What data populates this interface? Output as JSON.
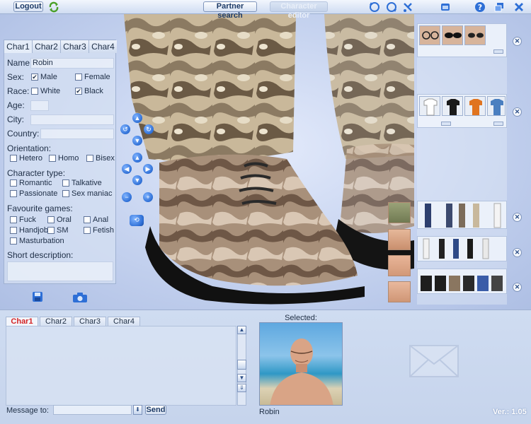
{
  "topbar": {
    "logout_label": "Logout",
    "partner_search_label": "Partner search",
    "character_editor_label": "Character editor"
  },
  "profile": {
    "tabs": [
      "Char1",
      "Char2",
      "Char3",
      "Char4"
    ],
    "name_label": "Name:",
    "name_value": "Robin",
    "sex_label": "Sex:",
    "sex_options": {
      "male": "Male",
      "female": "Female"
    },
    "race_label": "Race:",
    "race_options": {
      "white": "White",
      "black": "Black"
    },
    "age_label": "Age:",
    "city_label": "City:",
    "country_label": "Country:",
    "orientation_label": "Orientation:",
    "orientation_options": {
      "hetero": "Hetero",
      "homo": "Homo",
      "bisex": "Bisex"
    },
    "character_type_label": "Character type:",
    "character_type_options": {
      "romantic": "Romantic",
      "talkative": "Talkative",
      "passionate": "Passionate",
      "sex_maniac": "Sex maniac"
    },
    "favourite_games_label": "Favourite games:",
    "favourite_games_options": {
      "fuck": "Fuck",
      "oral": "Oral",
      "anal": "Anal",
      "handjob": "Handjob",
      "sm": "SM",
      "fetish": "Fetish",
      "masturbation": "Masturbation"
    },
    "short_description_label": "Short description:"
  },
  "chat": {
    "tabs": [
      "Char1",
      "Char2",
      "Char3",
      "Char4"
    ],
    "selected_label": "Selected:",
    "selected_name": "Robin",
    "message_to_label": "Message to:",
    "send_label": "Send",
    "version": "Ver.: 1.05"
  },
  "colors": {
    "accent": "#2e6fd6",
    "active_tab_text": "#d42424",
    "panel_bg": "#d6e1f3"
  }
}
